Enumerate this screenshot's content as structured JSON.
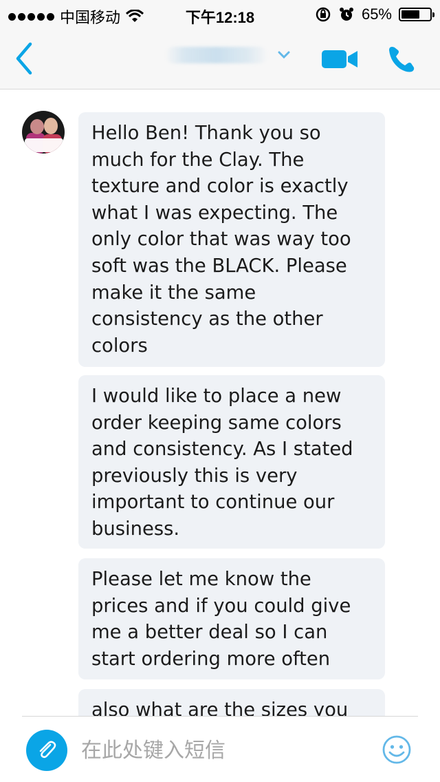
{
  "status_bar": {
    "carrier": "中国移动",
    "time": "下午12:18",
    "battery_percent": "65%",
    "battery_level": 0.65
  },
  "header": {
    "back_icon": "chevron-left-icon",
    "dropdown_icon": "chevron-down-icon",
    "video_icon": "video-camera-icon",
    "call_icon": "phone-icon",
    "accent_color": "#0aa5e6"
  },
  "messages": [
    {
      "text": "Hello Ben! Thank you so much for the Clay. The texture and color is exactly what I was expecting. The only color that was way too soft was the BLACK. Please make it the same consistency as the other colors"
    },
    {
      "text": "I would like to place a new order keeping same colors and consistency. As I stated previously this is very important to continue our business."
    },
    {
      "text": "Please let me know the prices and if you could give me a better deal so I can start ordering more often"
    },
    {
      "text": "also what are the sizes you"
    }
  ],
  "composer": {
    "placeholder": "在此处键入短信",
    "attach_icon": "paperclip-icon",
    "emoji_icon": "smiley-icon"
  },
  "colors": {
    "accent": "#0aa5e6",
    "bubble": "#eff2f6",
    "bar_background": "#f7f7f7"
  }
}
